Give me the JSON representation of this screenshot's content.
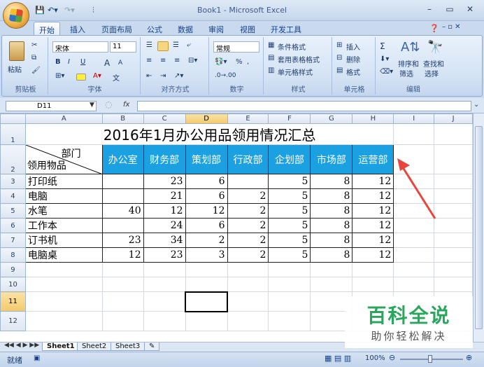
{
  "window": {
    "title": "Book1 - Microsoft Excel"
  },
  "ribbon_tabs": [
    "开始",
    "插入",
    "页面布局",
    "公式",
    "数据",
    "审阅",
    "视图",
    "开发工具"
  ],
  "ribbon": {
    "clipboard": {
      "paste": "粘贴",
      "label": "剪贴板"
    },
    "font": {
      "name": "宋体",
      "size": "11",
      "label": "字体",
      "bold": "B",
      "italic": "I",
      "underline": "U",
      "grow": "A",
      "shrink": "A",
      "phonetic": "文"
    },
    "alignment": {
      "label": "对齐方式"
    },
    "number": {
      "format": "常规",
      "percent": "%",
      "comma": ",",
      "label": "数字"
    },
    "styles": {
      "conditional": "条件格式",
      "table": "套用表格格式",
      "cell": "单元格样式",
      "label": "样式"
    },
    "cells": {
      "insert": "插入",
      "delete": "删除",
      "format": "格式",
      "label": "单元格"
    },
    "editing": {
      "sum": "Σ",
      "sort": "排序和",
      "sort2": "筛选",
      "find": "查找和",
      "find2": "选择",
      "label": "编辑"
    }
  },
  "formula_bar": {
    "name_box": "D11",
    "fx": "fx",
    "content": ""
  },
  "columns": [
    "A",
    "B",
    "C",
    "D",
    "E",
    "F",
    "G",
    "H",
    "I",
    "J"
  ],
  "rows": [
    "1",
    "2",
    "3",
    "4",
    "5",
    "6",
    "7",
    "8",
    "9",
    "10",
    "11",
    "12"
  ],
  "sheet": {
    "title": "2016年1月办公用品领用情况汇总",
    "corner_top": "部门",
    "corner_bottom": "领用物品",
    "departments": [
      "办公室",
      "财务部",
      "策划部",
      "行政部",
      "企划部",
      "市场部",
      "运营部"
    ],
    "items": [
      {
        "name": "打印纸",
        "values": [
          "",
          "23",
          "6",
          "",
          "5",
          "8",
          "12"
        ]
      },
      {
        "name": "电脑",
        "values": [
          "",
          "21",
          "6",
          "2",
          "5",
          "8",
          "12"
        ]
      },
      {
        "name": "水笔",
        "values": [
          "40",
          "12",
          "12",
          "2",
          "5",
          "8",
          "12"
        ]
      },
      {
        "name": "工作本",
        "values": [
          "",
          "24",
          "6",
          "2",
          "5",
          "8",
          "12"
        ]
      },
      {
        "name": "订书机",
        "values": [
          "23",
          "34",
          "2",
          "2",
          "5",
          "8",
          "12"
        ]
      },
      {
        "name": "电脑桌",
        "values": [
          "12",
          "23",
          "3",
          "2",
          "5",
          "8",
          "12"
        ]
      }
    ]
  },
  "sheet_tabs": [
    "Sheet1",
    "Sheet2",
    "Sheet3"
  ],
  "status": {
    "ready": "就绪",
    "zoom": "100%"
  },
  "watermark": {
    "title": "百科全说",
    "subtitle": "助你轻松解决"
  },
  "colors": {
    "header_fill": "#1ba1e2",
    "arrow": "#e8453c",
    "watermark": "#2aa75c"
  }
}
